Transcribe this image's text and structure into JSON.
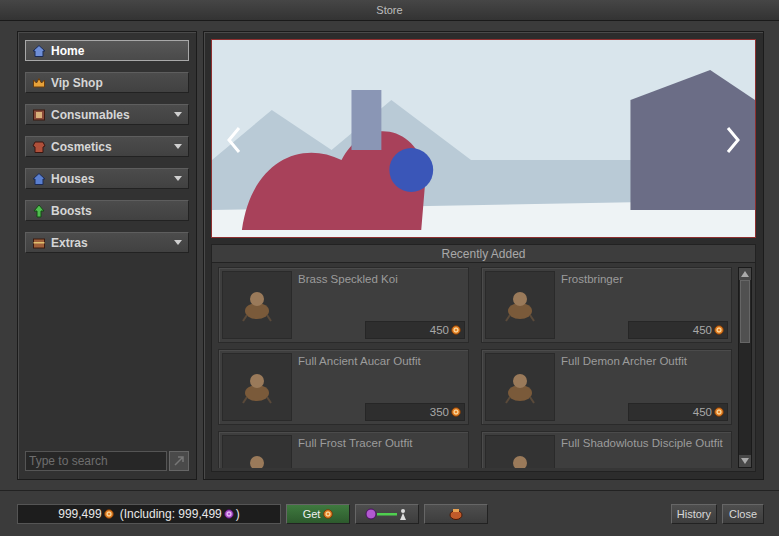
{
  "window": {
    "title": "Store"
  },
  "sidebar": {
    "items": [
      {
        "label": "Home",
        "selected": true,
        "expandable": false,
        "icon": "home"
      },
      {
        "label": "Vip Shop",
        "selected": false,
        "expandable": false,
        "icon": "crown"
      },
      {
        "label": "Consumables",
        "selected": false,
        "expandable": true,
        "icon": "potion"
      },
      {
        "label": "Cosmetics",
        "selected": false,
        "expandable": true,
        "icon": "shirt"
      },
      {
        "label": "Houses",
        "selected": false,
        "expandable": true,
        "icon": "house"
      },
      {
        "label": "Boosts",
        "selected": false,
        "expandable": false,
        "icon": "boost"
      },
      {
        "label": "Extras",
        "selected": false,
        "expandable": true,
        "icon": "chest"
      }
    ],
    "search": {
      "placeholder": "Type to search"
    }
  },
  "recently_added": {
    "title": "Recently Added",
    "items": [
      {
        "name": "Brass Speckled Koi",
        "price": "450"
      },
      {
        "name": "Frostbringer",
        "price": "450"
      },
      {
        "name": "Full Ancient Aucar Outfit",
        "price": "350"
      },
      {
        "name": "Full Demon Archer Outfit",
        "price": "450"
      },
      {
        "name": "Full Frost Tracer Outfit",
        "price": ""
      },
      {
        "name": "Full Shadowlotus Disciple Outfit",
        "price": ""
      }
    ],
    "scrollbar": {
      "position": 0,
      "thumb_share": 0.36
    }
  },
  "balance": {
    "coins": "999,499",
    "including_prefix": "(Including:",
    "including_coins": "999,499",
    "including_suffix": ")"
  },
  "buttons": {
    "get": "Get",
    "history": "History",
    "close": "Close"
  }
}
